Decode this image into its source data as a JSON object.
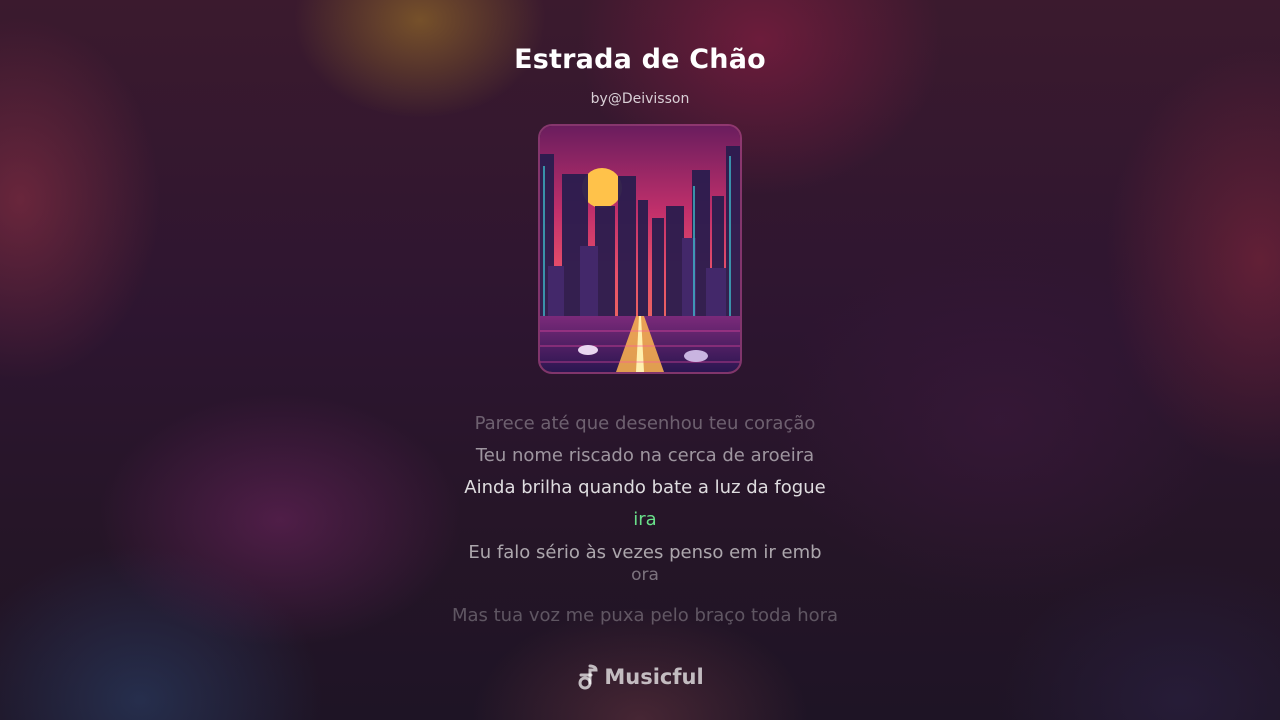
{
  "song": {
    "title": "Estrada de Chão",
    "artist": "by@Deivisson",
    "cover_icon": "city-sunset-artwork"
  },
  "lyrics": {
    "lines": [
      "Parece até que desenhou teu coração",
      "Teu nome riscado na cerca de aroeira",
      "Ainda brilha quando bate a luz da fogue",
      "ira",
      "Eu falo sério às vezes penso em ir emb",
      "ora",
      "Mas tua voz me puxa pelo braço toda hora"
    ],
    "highlight_color": "#69e08a"
  },
  "brand": {
    "name": "Musicful",
    "icon": "music-note-icon"
  }
}
